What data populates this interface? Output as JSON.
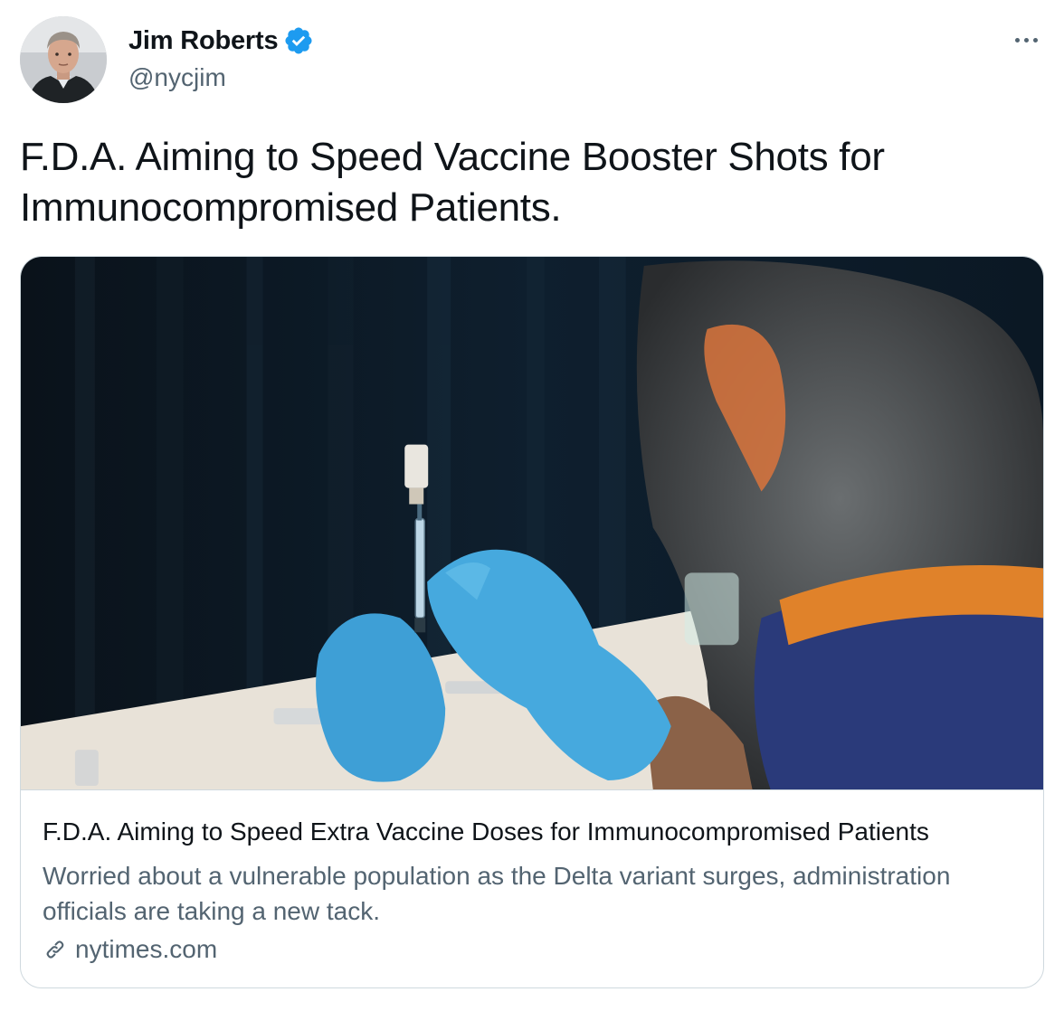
{
  "author": {
    "display_name": "Jim Roberts",
    "handle": "@nycjim",
    "verified": true,
    "avatar_icon": "person-avatar"
  },
  "tweet": {
    "text": "F.D.A. Aiming to Speed Vaccine Booster Shots for Immunocompromised Patients."
  },
  "card": {
    "image_icon": "vaccine-photo",
    "title": "F.D.A. Aiming to Speed Extra Vaccine Doses for Immunocompromised Patients",
    "description": "Worried about a vulnerable population as the Delta variant surges, administration officials are taking a new tack.",
    "domain": "nytimes.com",
    "link_icon": "link-icon"
  },
  "colors": {
    "primary_text": "#0f1419",
    "secondary_text": "#536471",
    "border": "#cfd9de",
    "verified_blue": "#1d9bf0"
  }
}
